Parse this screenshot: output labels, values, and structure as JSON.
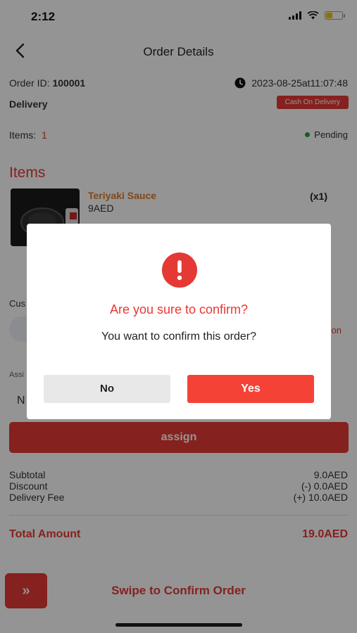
{
  "status_bar": {
    "time": "2:12"
  },
  "header": {
    "title": "Order Details",
    "back_icon": "chevron-left-icon"
  },
  "order": {
    "id_label": "Order ID:",
    "id_value": "100001",
    "datetime": "2023-08-25at11:07:48",
    "type": "Delivery",
    "payment_badge": "Cash On Delivery",
    "items_label": "Items:",
    "items_count": "1",
    "status": "Pending"
  },
  "items_section": {
    "title": "Items",
    "products": [
      {
        "name": "Teriyaki Sauce",
        "price": "9AED",
        "qty": "(x1)"
      }
    ]
  },
  "background_partial": {
    "cust_fragment": "Cus",
    "assi_fragment": "Assi",
    "n_fragment": "N",
    "on_fragment": "on"
  },
  "assign_button": {
    "label": "assign"
  },
  "summary": {
    "subtotal_label": "Subtotal",
    "subtotal_value": "9.0AED",
    "discount_label": "Discount",
    "discount_value": "(-) 0.0AED",
    "delivery_label": "Delivery Fee",
    "delivery_value": "(+) 10.0AED",
    "total_label": "Total Amount",
    "total_value": "19.0AED"
  },
  "swipe": {
    "handle": "»",
    "label": "Swipe to Confirm Order"
  },
  "dialog": {
    "icon": "alert-icon",
    "title": "Are you sure to confirm?",
    "message": "You want to confirm this order?",
    "no_label": "No",
    "yes_label": "Yes"
  },
  "colors": {
    "accent": "#e53935",
    "status_pending": "#2e9e3e",
    "product_name": "#e07b2a"
  }
}
